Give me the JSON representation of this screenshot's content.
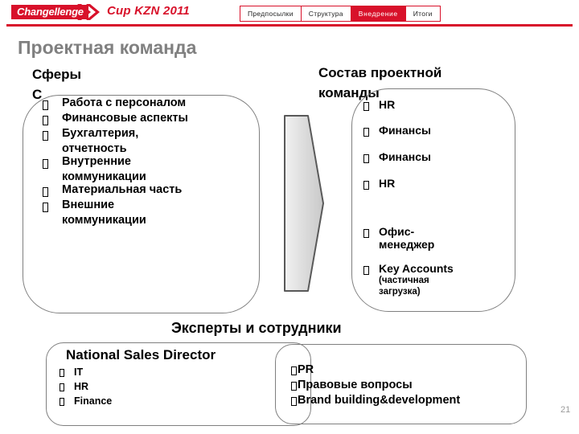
{
  "header": {
    "brand_tag": "Changellenge",
    "brand_chevron_icon": "double-chevron-right-icon",
    "brand_title": "Cup KZN 2011",
    "accent_color": "#d8112a",
    "tabs": [
      {
        "label": "Предпосылки",
        "active": false
      },
      {
        "label": "Структура",
        "active": false
      },
      {
        "label": "Внедрение",
        "active": true
      },
      {
        "label": "Итоги",
        "active": false
      }
    ]
  },
  "slide": {
    "title": "Проектная команда",
    "page_number": "21",
    "arrow_icon": "right-arrow-shape",
    "left_column": {
      "heading": "Сферы",
      "heading_line2": "С",
      "items": [
        {
          "text": "Работа с персоналом",
          "cont": ""
        },
        {
          "text": "Финансовые аспекты",
          "cont": ""
        },
        {
          "text": "Бухгалтерия,",
          "cont": "отчетность"
        },
        {
          "text": "Внутренние",
          "cont": "коммуникации"
        },
        {
          "text": "Материальная часть",
          "cont": ""
        },
        {
          "text": "Внешние",
          "cont": "коммуникации"
        }
      ]
    },
    "right_column": {
      "heading_line1": "Состав проектной",
      "heading_line2": "команды",
      "items": [
        {
          "text": "HR",
          "cont": "",
          "note": ""
        },
        {
          "text": "Финансы",
          "cont": "",
          "note": ""
        },
        {
          "text": "Финансы",
          "cont": "",
          "note": ""
        },
        {
          "text": "HR",
          "cont": "",
          "note": ""
        },
        {
          "text": "Офис-",
          "cont": "менеджер",
          "note": ""
        },
        {
          "text": "Key Accounts",
          "cont": "",
          "note": "(частичная загрузка)"
        }
      ]
    },
    "bottom": {
      "heading": "Эксперты и сотрудники",
      "left_box": {
        "title": "National Sales Director",
        "items": [
          "IT",
          "HR",
          "Finance"
        ]
      },
      "right_box": {
        "items": [
          "PR",
          "Правовые вопросы",
          "Brand building&development"
        ]
      }
    }
  }
}
